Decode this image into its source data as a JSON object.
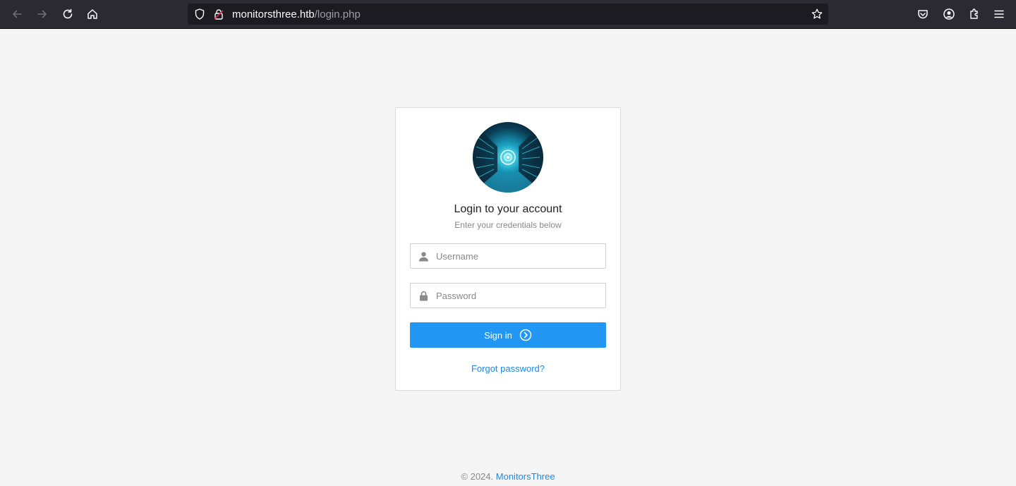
{
  "browser": {
    "url_host": "monitorsthree.htb",
    "url_path": "/login.php",
    "icons": [
      "back-icon",
      "forward-icon",
      "reload-icon",
      "home-icon",
      "tracking-shield-icon",
      "insecure-lock-icon",
      "bookmark-star-icon",
      "pocket-icon",
      "account-icon",
      "extensions-icon",
      "menu-icon"
    ]
  },
  "login": {
    "title": "Login to your account",
    "subtitle": "Enter your credentials below",
    "username_placeholder": "Username",
    "password_placeholder": "Password",
    "signin_label": "Sign in",
    "forgot_label": "Forgot password?"
  },
  "footer": {
    "copyright": "© 2024.",
    "brand": "MonitorsThree"
  },
  "colors": {
    "primary": "#2196f3",
    "link": "#1e88e5",
    "page_bg": "#f5f5f5",
    "chrome_bg": "#2b2a33"
  }
}
